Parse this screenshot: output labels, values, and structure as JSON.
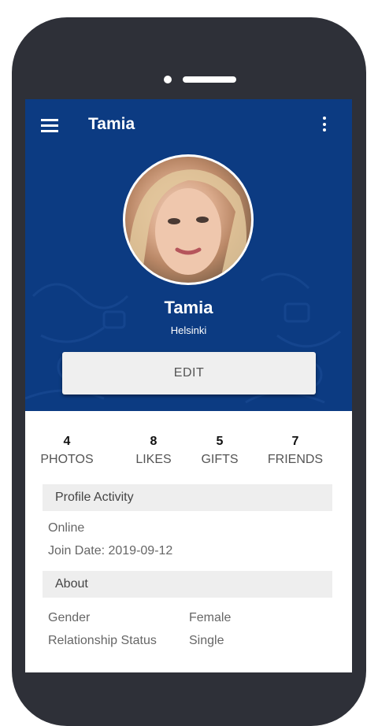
{
  "app_bar": {
    "title": "Tamia"
  },
  "profile": {
    "name": "Tamia",
    "city": "Helsinki",
    "edit_label": "EDIT"
  },
  "stats": [
    {
      "count": "4",
      "label": "PHOTOS"
    },
    {
      "count": "8",
      "label": "LIKES"
    },
    {
      "count": "5",
      "label": "GIFTS"
    },
    {
      "count": "7",
      "label": "FRIENDS"
    }
  ],
  "activity": {
    "heading": "Profile Activity",
    "status": "Online",
    "join_date": "Join Date: 2019-09-12"
  },
  "about": {
    "heading": "About",
    "rows": [
      {
        "label": "Gender",
        "value": "Female"
      },
      {
        "label": "Relationship Status",
        "value": "Single"
      }
    ]
  },
  "colors": {
    "header_bg": "#0c3b82",
    "phone_frame": "#2e3038",
    "section_bg": "#eeeeee"
  },
  "icons": {
    "menu": "hamburger-menu-icon",
    "more": "more-vertical-icon"
  }
}
